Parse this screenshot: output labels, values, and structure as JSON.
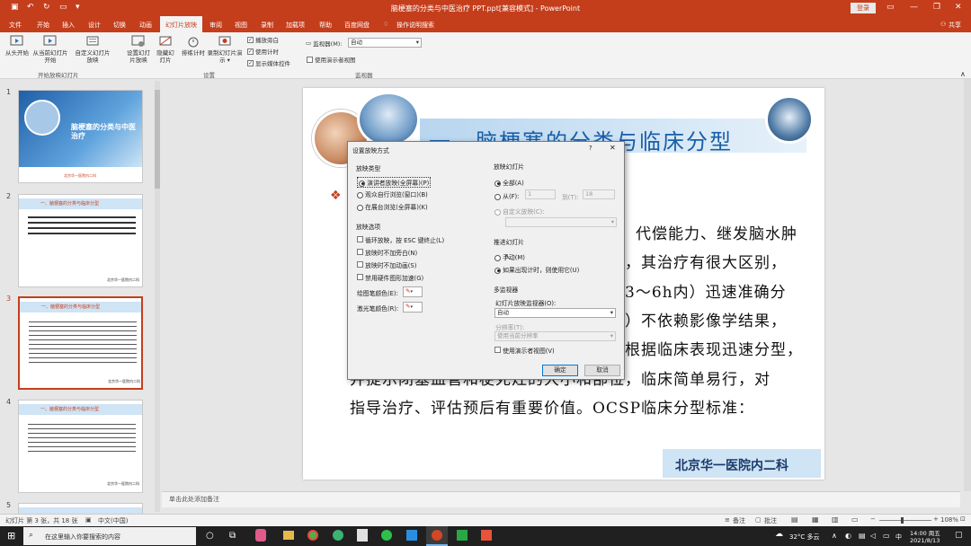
{
  "window": {
    "title": "脑梗塞的分类与中医治疗 PPT.ppt[兼容模式] - PowerPoint",
    "login": "登录"
  },
  "menu": {
    "tabs": [
      "文件",
      "开始",
      "插入",
      "设计",
      "切换",
      "动画",
      "幻灯片放映",
      "审阅",
      "视图",
      "录制",
      "加载项",
      "帮助",
      "百度网盘",
      "操作说明搜索"
    ],
    "share": "共享"
  },
  "ribbon": {
    "buttons": [
      "从头开始",
      "从当前幻灯片开始",
      "自定义幻灯片放映",
      "设置幻灯片放映",
      "隐藏幻灯片",
      "排练计时",
      "录制幻灯片演示"
    ],
    "checks": [
      "播放旁白",
      "使用计时",
      "显示媒体控件"
    ],
    "monitor_label": "监视器(M):",
    "monitor_value": "自动",
    "presenter_view": "使用演示者视图",
    "groups": [
      "开始放映幻灯片",
      "设置",
      "监视器"
    ]
  },
  "slides": {
    "numbers": [
      "1",
      "2",
      "3",
      "4",
      "5"
    ],
    "thumb1_title": "脑梗塞的分类与中医治疗",
    "thumb_header": "一、脑梗塞的分类与临床分型",
    "thumb_footer": "北京华一医院内二科"
  },
  "slide": {
    "title": "一、脑梗塞的分类与临床分型",
    "lines": [
      "代偿能力、继发脑水肿",
      "，其治疗有很大区别，",
      "3～6h内）迅速准确分",
      "）不依赖影像学结果，",
      "根据临床表现迅速分型，",
      "并提示闭塞血管和梗死灶的大小和部位，临床简单易行，对",
      "指导治疗、评估预后有重要价值。OCSP临床分型标准："
    ],
    "footer": "北京华一医院内二科"
  },
  "notes": {
    "placeholder": "单击此处添加备注"
  },
  "status": {
    "slide_info": "幻灯片 第 3 张，共 18 张",
    "language": "中文(中国)",
    "notes_btn": "备注",
    "comments_btn": "批注",
    "zoom": "108%"
  },
  "dialog": {
    "title": "设置放映方式",
    "help": "?",
    "type_section": "放映类型",
    "types": [
      "演讲者放映(全屏幕)(P)",
      "观众自行浏览(窗口)(B)",
      "在展台浏览(全屏幕)(K)"
    ],
    "options_section": "放映选项",
    "options": [
      "循环放映，按 ESC 键终止(L)",
      "放映时不加旁白(N)",
      "放映时不加动画(S)",
      "禁用硬件图形加速(G)"
    ],
    "pen_color": "绘图笔颜色(E):",
    "laser_color": "激光笔颜色(R):",
    "slides_section": "放映幻灯片",
    "all": "全部(A)",
    "from": "从(F):",
    "from_value": "1",
    "to": "到(T):",
    "to_value": "18",
    "custom": "自定义放映(C):",
    "advance_section": "推进幻灯片",
    "manual": "手动(M)",
    "timing": "如果出现计时，则使用它(U)",
    "monitors_section": "多监视器",
    "monitor_label": "幻灯片放映监视器(O):",
    "monitor_value": "自动",
    "resolution_label": "分辨率(T):",
    "resolution_value": "使用当前分辨率",
    "presenter": "使用演示者视图(V)",
    "ok": "确定",
    "cancel": "取消",
    "pen_hex": "#e02020"
  },
  "taskbar": {
    "search": "在这里输入你要搜索的内容",
    "weather": "32°C 多云",
    "time": "14:00 周五",
    "date": "2021/8/13",
    "lang": "中"
  }
}
